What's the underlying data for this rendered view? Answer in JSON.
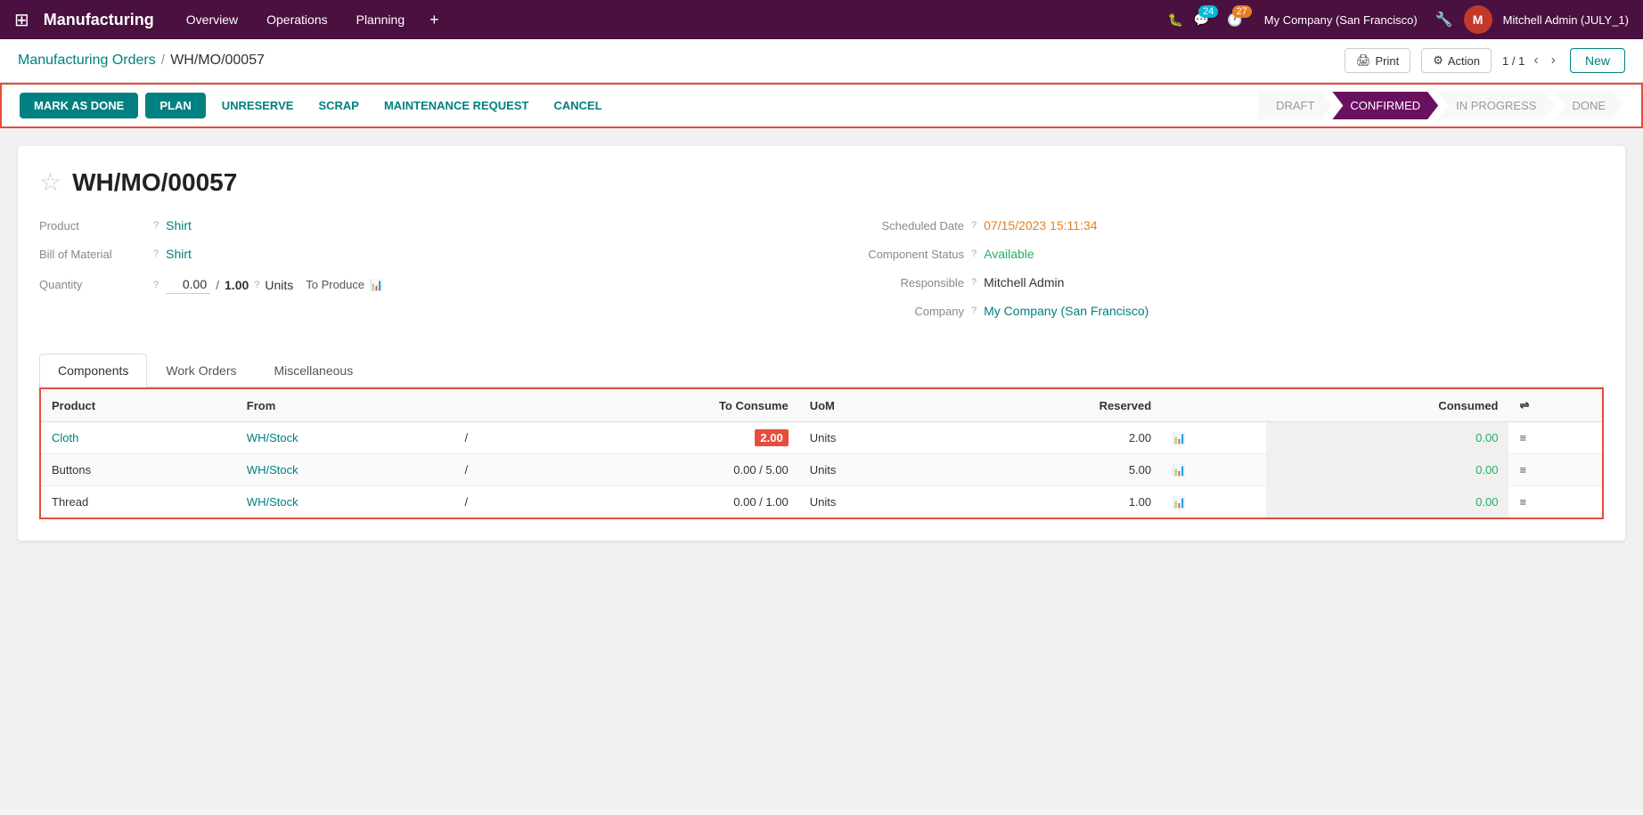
{
  "app": {
    "name": "Manufacturing",
    "nav_items": [
      "Overview",
      "Operations",
      "Planning"
    ],
    "badge_chat": "24",
    "badge_activity": "27",
    "company": "My Company (San Francisco)",
    "user": "Mitchell Admin (JULY_1)"
  },
  "header": {
    "breadcrumb_parent": "Manufacturing Orders",
    "breadcrumb_current": "WH/MO/00057",
    "print_label": "Print",
    "action_label": "Action",
    "pagination": "1 / 1",
    "new_label": "New"
  },
  "action_bar": {
    "mark_as_done": "MARK AS DONE",
    "plan": "PLAN",
    "unreserve": "UNRESERVE",
    "scrap": "SCRAP",
    "maintenance_request": "MAINTENANCE REQUEST",
    "cancel": "CANCEL"
  },
  "status_steps": [
    {
      "label": "DRAFT",
      "active": false
    },
    {
      "label": "CONFIRMED",
      "active": true
    },
    {
      "label": "IN PROGRESS",
      "active": false
    },
    {
      "label": "DONE",
      "active": false
    }
  ],
  "form": {
    "order_number": "WH/MO/00057",
    "product_label": "Product",
    "product_value": "Shirt",
    "bom_label": "Bill of Material",
    "bom_value": "Shirt",
    "qty_label": "Quantity",
    "qty_done": "0.00",
    "qty_slash": "/",
    "qty_total": "1.00",
    "qty_unit": "Units",
    "to_produce_label": "To Produce",
    "scheduled_date_label": "Scheduled Date",
    "scheduled_date_value": "07/15/2023 15:11:34",
    "component_status_label": "Component Status",
    "component_status_value": "Available",
    "responsible_label": "Responsible",
    "responsible_value": "Mitchell Admin",
    "company_label": "Company",
    "company_value": "My Company (San Francisco)"
  },
  "tabs": [
    "Components",
    "Work Orders",
    "Miscellaneous"
  ],
  "active_tab": "Components",
  "table": {
    "headers": [
      "Product",
      "From",
      "",
      "To Consume",
      "UoM",
      "Reserved",
      "",
      "Consumed",
      ""
    ],
    "rows": [
      {
        "product": "Cloth",
        "from": "WH/Stock",
        "separator": "/",
        "to_consume_value": "2.00",
        "to_consume_highlight": true,
        "to_consume_prefix": "",
        "to_consume_slash": "",
        "uom": "Units",
        "reserved": "2.00",
        "consumed": "0.00"
      },
      {
        "product": "Buttons",
        "from": "WH/Stock",
        "separator": "/",
        "to_consume_value": "5.00",
        "to_consume_highlight": false,
        "to_consume_prefix": "0.00",
        "to_consume_slash": "/",
        "uom": "Units",
        "reserved": "5.00",
        "consumed": "0.00"
      },
      {
        "product": "Thread",
        "from": "WH/Stock",
        "separator": "/",
        "to_consume_value": "1.00",
        "to_consume_highlight": false,
        "to_consume_prefix": "0.00",
        "to_consume_slash": "/",
        "uom": "Units",
        "reserved": "1.00",
        "consumed": "0.00"
      }
    ]
  }
}
